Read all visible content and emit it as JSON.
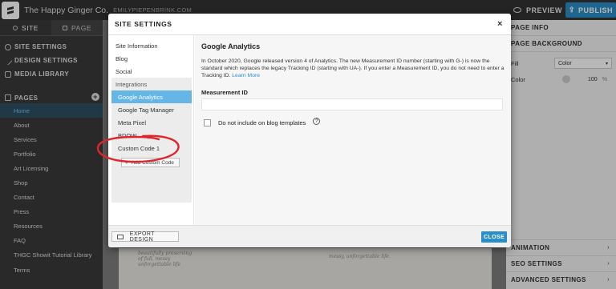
{
  "topbar": {
    "site_name": "The Happy Ginger Co.",
    "site_url": "EMILYPIEPENBRINK.COM",
    "preview_label": "PREVIEW",
    "publish_label": "PUBLISH",
    "accent": "#2a8ec7"
  },
  "left_sidebar": {
    "tabs": [
      {
        "label": "SITE",
        "active": true
      },
      {
        "label": "PAGE",
        "active": false
      }
    ],
    "menu": [
      {
        "label": "SITE SETTINGS",
        "icon": "gear-icon"
      },
      {
        "label": "DESIGN SETTINGS",
        "icon": "pencil-icon"
      },
      {
        "label": "MEDIA LIBRARY",
        "icon": "image-icon"
      }
    ],
    "pages_label": "PAGES",
    "pages": [
      "Home",
      "About",
      "Services",
      "Portfolio",
      "Art Licensing",
      "Shop",
      "Contact",
      "Press",
      "Resources",
      "FAQ",
      "THGC Showit Tutorial Library",
      "Terms"
    ],
    "active_page": "Home"
  },
  "right_sidebar": {
    "page_info_label": "PAGE INFO",
    "page_background_label": "PAGE BACKGROUND",
    "fill_label": "Fill",
    "fill_value": "Color",
    "color_label": "Color",
    "opacity_value": "100",
    "opacity_unit": "%",
    "animation_label": "ANIMATION",
    "seo_label": "SEO SETTINGS",
    "advanced_label": "ADVANCED SETTINGS"
  },
  "canvas": {
    "text_left": "beautifully preserving\nof full, messy\nunforgettable life",
    "text_right": "messy, unforgettable life."
  },
  "modal": {
    "title": "SITE SETTINGS",
    "close_glyph": "×",
    "nav": {
      "items": [
        "Site Information",
        "Blog",
        "Social"
      ],
      "group_label": "Integrations",
      "group_items": [
        "Google Analytics",
        "Google Tag Manager",
        "Meta Pixel",
        "BDOW",
        "Custom Code 1"
      ],
      "active_item": "Google Analytics",
      "add_button": "Add Custom Code"
    },
    "content": {
      "heading": "Google Analytics",
      "description": "In October 2020, Google released version 4 of Analytics. The new Measurement ID number (starting with G-) is now the standard which replaces the legacy Tracking ID (starting with UA-). If you enter a Measurement ID, you do not need to enter a Tracking ID.",
      "learn_more": "Learn More",
      "field_label": "Measurement ID",
      "field_value": "",
      "checkbox_label": "Do not include on blog templates",
      "checkbox_checked": false,
      "help_glyph": "?"
    },
    "footer": {
      "export_label": "EXPORT DESIGN",
      "close_label": "CLOSE"
    }
  },
  "annotation": {
    "color": "#e0242b",
    "target": "Custom Code 1"
  }
}
